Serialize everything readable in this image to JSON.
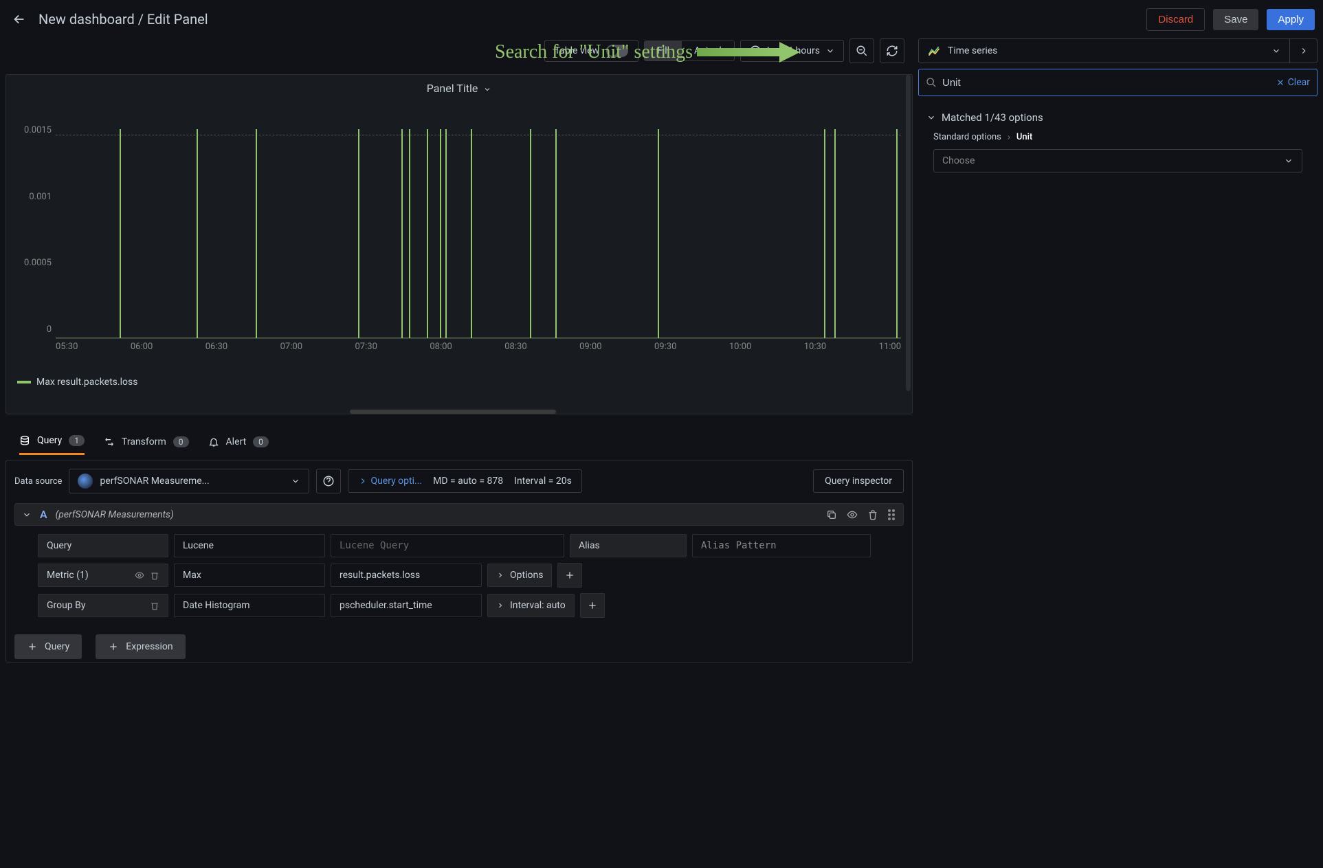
{
  "header": {
    "title": "New dashboard / Edit Panel",
    "discard": "Discard",
    "save": "Save",
    "apply": "Apply"
  },
  "toolbar": {
    "table_view": "Table view",
    "fill": "Fill",
    "actual": "Actual",
    "time_range": "Last 6 hours",
    "viz_type": "Time series"
  },
  "panel": {
    "title": "Panel Title"
  },
  "chart_data": {
    "type": "bar",
    "title": "Panel Title",
    "xlabel": "",
    "ylabel": "",
    "ylim": [
      0,
      0.0017
    ],
    "yticks": [
      "0.0015",
      "0.001",
      "0.0005",
      "0"
    ],
    "x_ticks": [
      "05:30",
      "06:00",
      "06:30",
      "07:00",
      "07:30",
      "08:00",
      "08:30",
      "09:00",
      "09:30",
      "10:00",
      "10:30",
      "11:00"
    ],
    "series": [
      {
        "name": "Max result.packets.loss",
        "color": "#91c46c",
        "points": [
          {
            "x": "05:55",
            "y": 0.0015
          },
          {
            "x": "06:25",
            "y": 0.0015
          },
          {
            "x": "06:48",
            "y": 0.0015
          },
          {
            "x": "07:28",
            "y": 0.0015
          },
          {
            "x": "07:45",
            "y": 0.0015
          },
          {
            "x": "07:48",
            "y": 0.0015
          },
          {
            "x": "07:55",
            "y": 0.0015
          },
          {
            "x": "08:00",
            "y": 0.0015
          },
          {
            "x": "08:02",
            "y": 0.0015
          },
          {
            "x": "08:12",
            "y": 0.0015
          },
          {
            "x": "08:35",
            "y": 0.0015
          },
          {
            "x": "08:45",
            "y": 0.0015
          },
          {
            "x": "09:25",
            "y": 0.0015
          },
          {
            "x": "10:30",
            "y": 0.0015
          },
          {
            "x": "10:34",
            "y": 0.0015
          },
          {
            "x": "10:58",
            "y": 0.0015
          }
        ]
      }
    ],
    "legend_position": "bottom-left"
  },
  "annotation": {
    "text": "Search for \"Unit\" settings"
  },
  "sidebar": {
    "search_value": "Unit",
    "clear": "Clear",
    "matched_label": "Matched 1/43 options",
    "breadcrumb_parent": "Standard options",
    "breadcrumb_leaf": "Unit",
    "choose_placeholder": "Choose"
  },
  "tabs": {
    "query": "Query",
    "query_count": "1",
    "transform": "Transform",
    "transform_count": "0",
    "alert": "Alert",
    "alert_count": "0"
  },
  "datasource": {
    "label": "Data source",
    "name": "perfSONAR Measureme...",
    "query_options": "Query opti...",
    "summary_md": "MD = auto = 878",
    "summary_interval": "Interval = 20s",
    "inspector": "Query inspector"
  },
  "queryA": {
    "letter": "A",
    "name": "(perfSONAR Measurements)",
    "query_label": "Query",
    "lucene": "Lucene",
    "lucene_placeholder": "Lucene Query",
    "alias_label": "Alias",
    "alias_placeholder": "Alias Pattern",
    "metric_label": "Metric (1)",
    "metric_agg": "Max",
    "metric_field": "result.packets.loss",
    "options": "Options",
    "groupby_label": "Group By",
    "groupby_agg": "Date Histogram",
    "groupby_field": "pscheduler.start_time",
    "interval": "Interval: auto"
  },
  "bottom": {
    "add_query": "Query",
    "add_expression": "Expression"
  }
}
